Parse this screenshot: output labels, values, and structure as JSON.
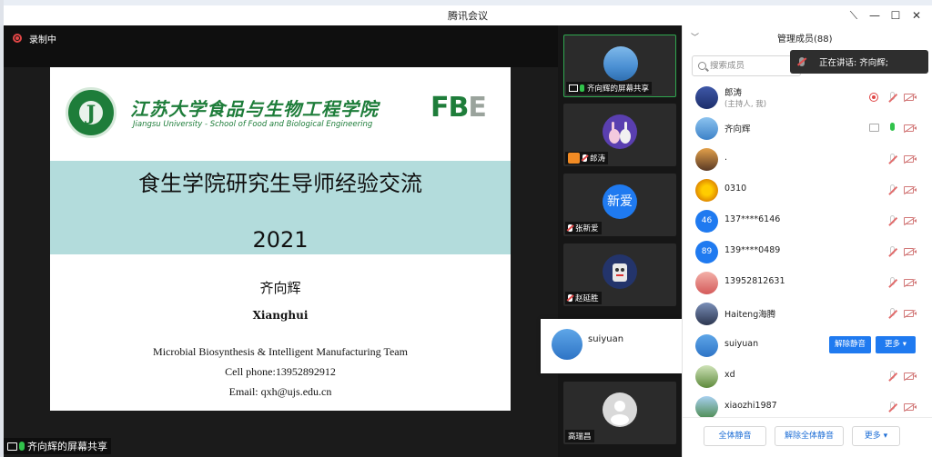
{
  "window": {
    "title": "腾讯会议"
  },
  "stage": {
    "recording_label": "录制中",
    "share_label": "齐向辉的屏幕共享"
  },
  "slide": {
    "logo_letter": "J",
    "university_cn": "江苏大学食品与生物工程学院",
    "university_en": "Jiangsu University - School of Food and Biological Engineering",
    "logo_fbe": "FB",
    "logo_fbe_e": "E",
    "title": "食生学院研究生导师经验交流",
    "year": "2021",
    "speaker_cn": "齐向辉",
    "speaker_en": "Xianghui",
    "team": "Microbial Biosynthesis & Intelligent Manufacturing Team",
    "phone": "Cell phone:13952892912",
    "email": "Email: qxh@ujs.edu.cn"
  },
  "thumbnails": [
    {
      "label": "齐向辉的屏幕共享",
      "active": true
    },
    {
      "label": "郎涛"
    },
    {
      "label": "张新爱",
      "avatar_text": "新爱"
    },
    {
      "label": "赵延胜"
    },
    {
      "label": "高瑞昌"
    }
  ],
  "popup": {
    "name": "suiyuan"
  },
  "panel": {
    "header": "管理成员(88)",
    "search_placeholder": "搜索成员",
    "speaking": "正在讲话: 齐向辉;",
    "members": [
      {
        "name": "郎涛",
        "sub": "(主持人, 我)"
      },
      {
        "name": "齐向辉"
      },
      {
        "name": "."
      },
      {
        "name": "0310"
      },
      {
        "name": "137****6146",
        "avatar_text": "46"
      },
      {
        "name": "139****0489",
        "avatar_text": "89"
      },
      {
        "name": "13952812631"
      },
      {
        "name": "Haiteng海腾"
      },
      {
        "name": "suiyuan",
        "unmute_label": "解除静音",
        "more_label": "更多 ▾"
      },
      {
        "name": "xd"
      },
      {
        "name": "xiaozhi1987"
      }
    ],
    "footer": {
      "mute_all": "全体静音",
      "unmute_all": "解除全体静音",
      "more": "更多 ▾"
    }
  },
  "colors": {
    "accent": "#1f7af0",
    "brand_green": "#1e7d3a",
    "slide_band": "#b3dcdc"
  }
}
